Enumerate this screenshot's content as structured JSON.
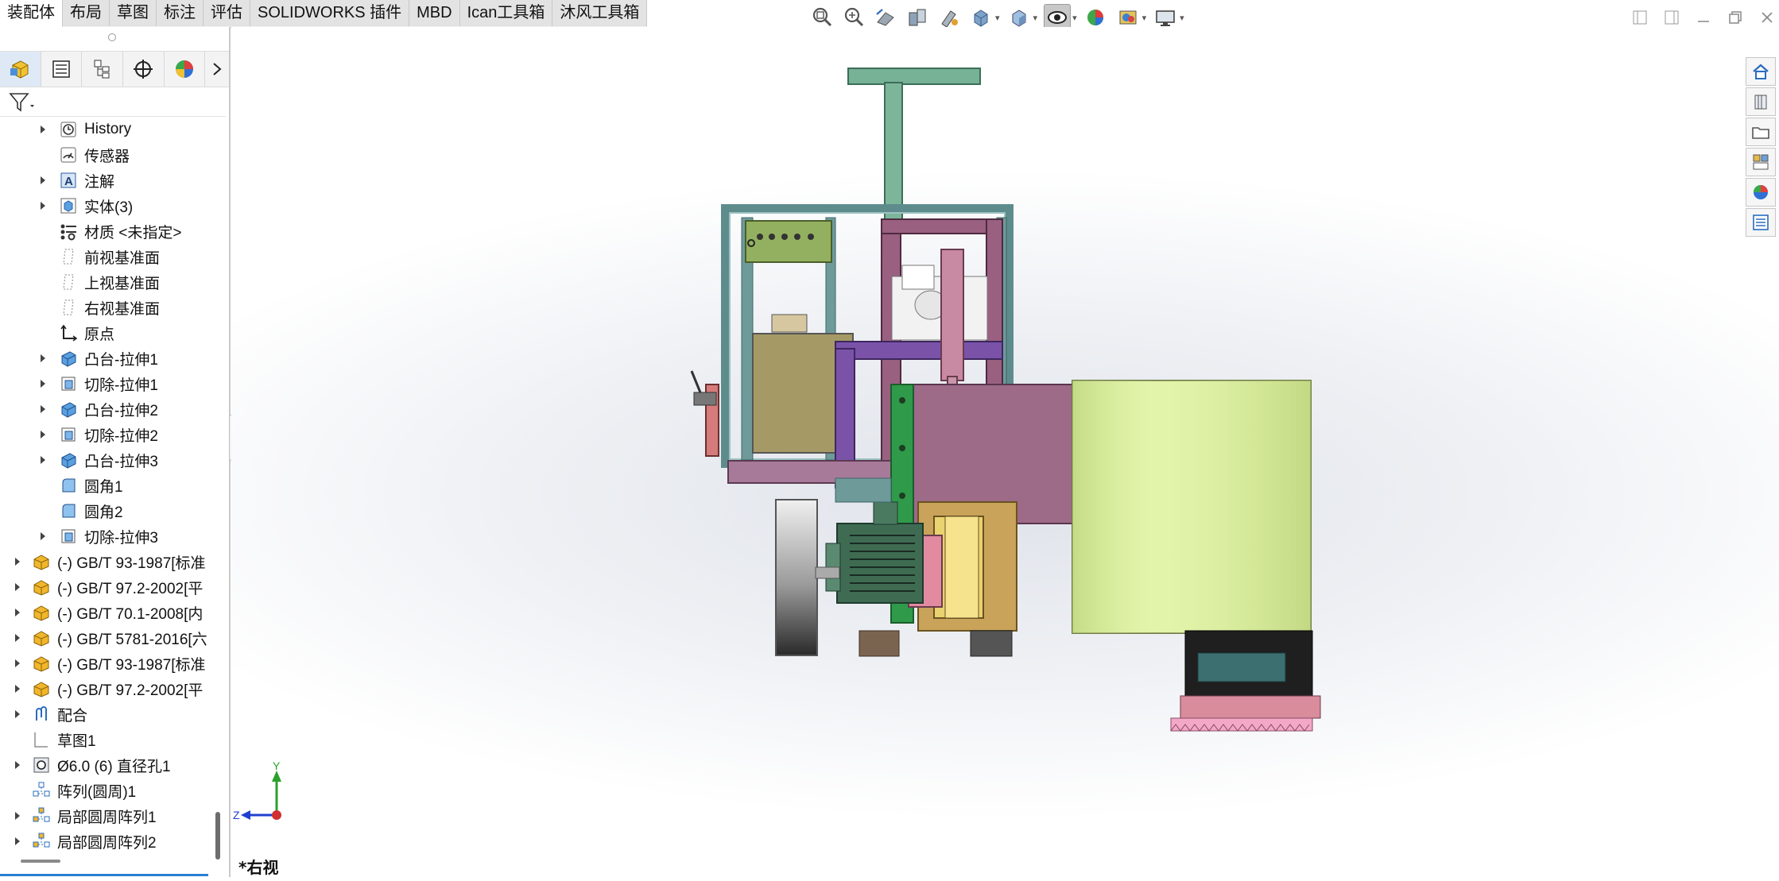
{
  "tabs": [
    {
      "label": "装配体",
      "active": true
    },
    {
      "label": "布局"
    },
    {
      "label": "草图"
    },
    {
      "label": "标注"
    },
    {
      "label": "评估"
    },
    {
      "label": "SOLIDWORKS 插件"
    },
    {
      "label": "MBD"
    },
    {
      "label": "Ican工具箱"
    },
    {
      "label": "沐风工具箱"
    }
  ],
  "hud_icons": [
    "zoom-to-fit-icon",
    "zoom-area-icon",
    "previous-view-icon",
    "section-view-icon",
    "dynamic-annotation-icon",
    "view-orientation-icon",
    "display-style-icon",
    "hide-show-items-icon",
    "edit-appearance-icon",
    "apply-scene-icon",
    "view-settings-icon"
  ],
  "tree": {
    "items": [
      {
        "label": "History",
        "icon": "history-icon",
        "expand": true
      },
      {
        "label": "传感器",
        "icon": "sensor-icon",
        "expand": false
      },
      {
        "label": "注解",
        "icon": "annotation-icon",
        "expand": true
      },
      {
        "label": "实体(3)",
        "icon": "solid-body-icon",
        "expand": true
      },
      {
        "label": "材质 <未指定>",
        "icon": "material-icon",
        "expand": false
      },
      {
        "label": "前视基准面",
        "icon": "plane-icon",
        "expand": false
      },
      {
        "label": "上视基准面",
        "icon": "plane-icon",
        "expand": false
      },
      {
        "label": "右视基准面",
        "icon": "plane-icon",
        "expand": false
      },
      {
        "label": "原点",
        "icon": "origin-icon",
        "expand": false
      },
      {
        "label": "凸台-拉伸1",
        "icon": "boss-extrude-icon",
        "expand": true
      },
      {
        "label": "切除-拉伸1",
        "icon": "cut-extrude-icon",
        "expand": true
      },
      {
        "label": "凸台-拉伸2",
        "icon": "boss-extrude-icon",
        "expand": true
      },
      {
        "label": "切除-拉伸2",
        "icon": "cut-extrude-icon",
        "expand": true
      },
      {
        "label": "凸台-拉伸3",
        "icon": "boss-extrude-icon",
        "expand": true
      },
      {
        "label": "圆角1",
        "icon": "fillet-icon",
        "expand": false
      },
      {
        "label": "圆角2",
        "icon": "fillet-icon",
        "expand": false
      },
      {
        "label": "切除-拉伸3",
        "icon": "cut-extrude-icon",
        "expand": true
      },
      {
        "label": "(-) GB/T 93-1987[标准",
        "icon": "part-icon",
        "expand": true
      },
      {
        "label": "(-) GB/T 97.2-2002[平",
        "icon": "part-icon",
        "expand": true
      },
      {
        "label": "(-) GB/T 70.1-2008[内",
        "icon": "part-icon",
        "expand": true
      },
      {
        "label": "(-) GB/T 5781-2016[六",
        "icon": "part-icon",
        "expand": true
      },
      {
        "label": "(-) GB/T 93-1987[标准",
        "icon": "part-icon",
        "expand": true
      },
      {
        "label": "(-) GB/T 97.2-2002[平",
        "icon": "part-icon",
        "expand": true
      },
      {
        "label": "配合",
        "icon": "mates-icon",
        "expand": true
      },
      {
        "label": "草图1",
        "icon": "sketch-icon",
        "expand": false
      },
      {
        "label": "Ø6.0 (6) 直径孔1",
        "icon": "hole-icon",
        "expand": true
      },
      {
        "label": "阵列(圆周)1",
        "icon": "circular-pattern-icon",
        "expand": false
      },
      {
        "label": "局部圆周阵列1",
        "icon": "local-pattern-icon",
        "expand": true
      },
      {
        "label": "局部圆周阵列2",
        "icon": "local-pattern-icon",
        "expand": true
      }
    ]
  },
  "viewport": {
    "view_name": "*右视",
    "triad": {
      "y": "Y",
      "z": "Z"
    }
  },
  "colors": {
    "accent": "#2a7fd4",
    "frame": "#5e8c8c",
    "drum": "#dcf0a0",
    "motor": "#3f6b53"
  }
}
